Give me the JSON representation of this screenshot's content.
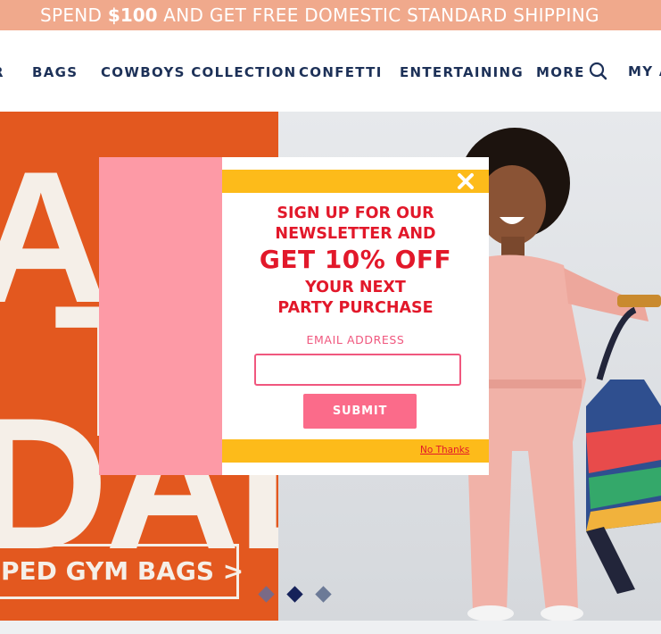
{
  "promo": {
    "prefix": "SPEND ",
    "amount": "$100",
    "suffix": " AND GET FREE DOMESTIC STANDARD SHIPPING"
  },
  "nav": {
    "items": [
      {
        "label": "R"
      },
      {
        "label": "BAGS"
      },
      {
        "label": "COWBOYS COLLECTION"
      },
      {
        "label": "CONFETTI"
      },
      {
        "label": "ENTERTAINING"
      },
      {
        "label": "MORE"
      }
    ],
    "account_label": "MY A",
    "search_icon": "search-icon"
  },
  "hero": {
    "letters": [
      "AR",
      "T",
      "DAD!"
    ],
    "cta_label": "PED GYM BAGS >",
    "left_color": "#e3581f",
    "carousel": {
      "count": 3,
      "active_index": 1
    }
  },
  "modal": {
    "headline_lines": [
      "SIGN UP FOR OUR",
      "NEWSLETTER AND",
      "GET 10% OFF",
      "YOUR NEXT",
      "PARTY PURCHASE"
    ],
    "email_label": "EMAIL ADDRESS",
    "email_value": "",
    "email_placeholder": "",
    "submit_label": "SUBMIT",
    "no_thanks_label": "No Thanks",
    "close_icon": "close-icon",
    "accent": "#fdbb1a",
    "text_color": "#e2182a",
    "pink": "#fd9aa6"
  }
}
